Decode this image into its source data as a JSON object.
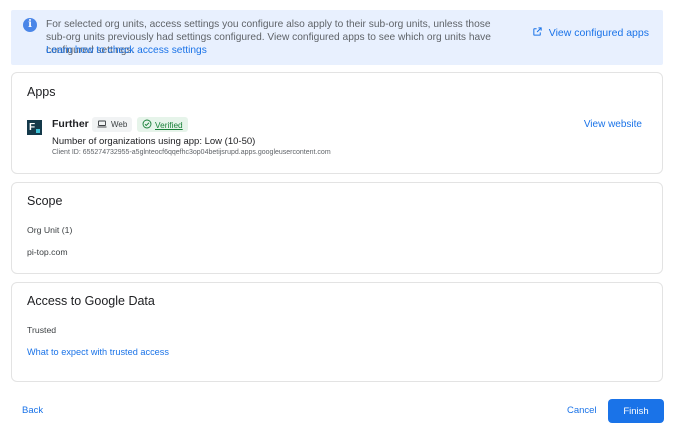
{
  "banner": {
    "text": "For selected org units, access settings you configure also apply to their sub-org units, unless those sub-org units previously had settings configured. View configured apps to see which org units have configured settings.",
    "link": "Learn how to check access settings",
    "view_configured": "View configured apps"
  },
  "apps": {
    "title": "Apps",
    "app_name": "Further",
    "web_chip": "Web",
    "verified_chip": "Verified",
    "org_count": "Number of organizations using app: Low (10-50)",
    "client_id": "Client ID: 655274732955-a5glnteocf6qqefhc3op04betijsrupd.apps.googleusercontent.com",
    "view_website": "View website",
    "logo_letter": "F"
  },
  "scope": {
    "title": "Scope",
    "label": "Org Unit (1)",
    "value": "pi-top.com"
  },
  "access": {
    "title": "Access to Google Data",
    "label": "Trusted",
    "link": "What to expect with trusted access"
  },
  "footer": {
    "back": "Back",
    "cancel": "Cancel",
    "finish": "Finish"
  },
  "colors": {
    "accent": "#1a73e8",
    "banner_bg": "#e8f0fe",
    "verified_green": "#188038"
  }
}
